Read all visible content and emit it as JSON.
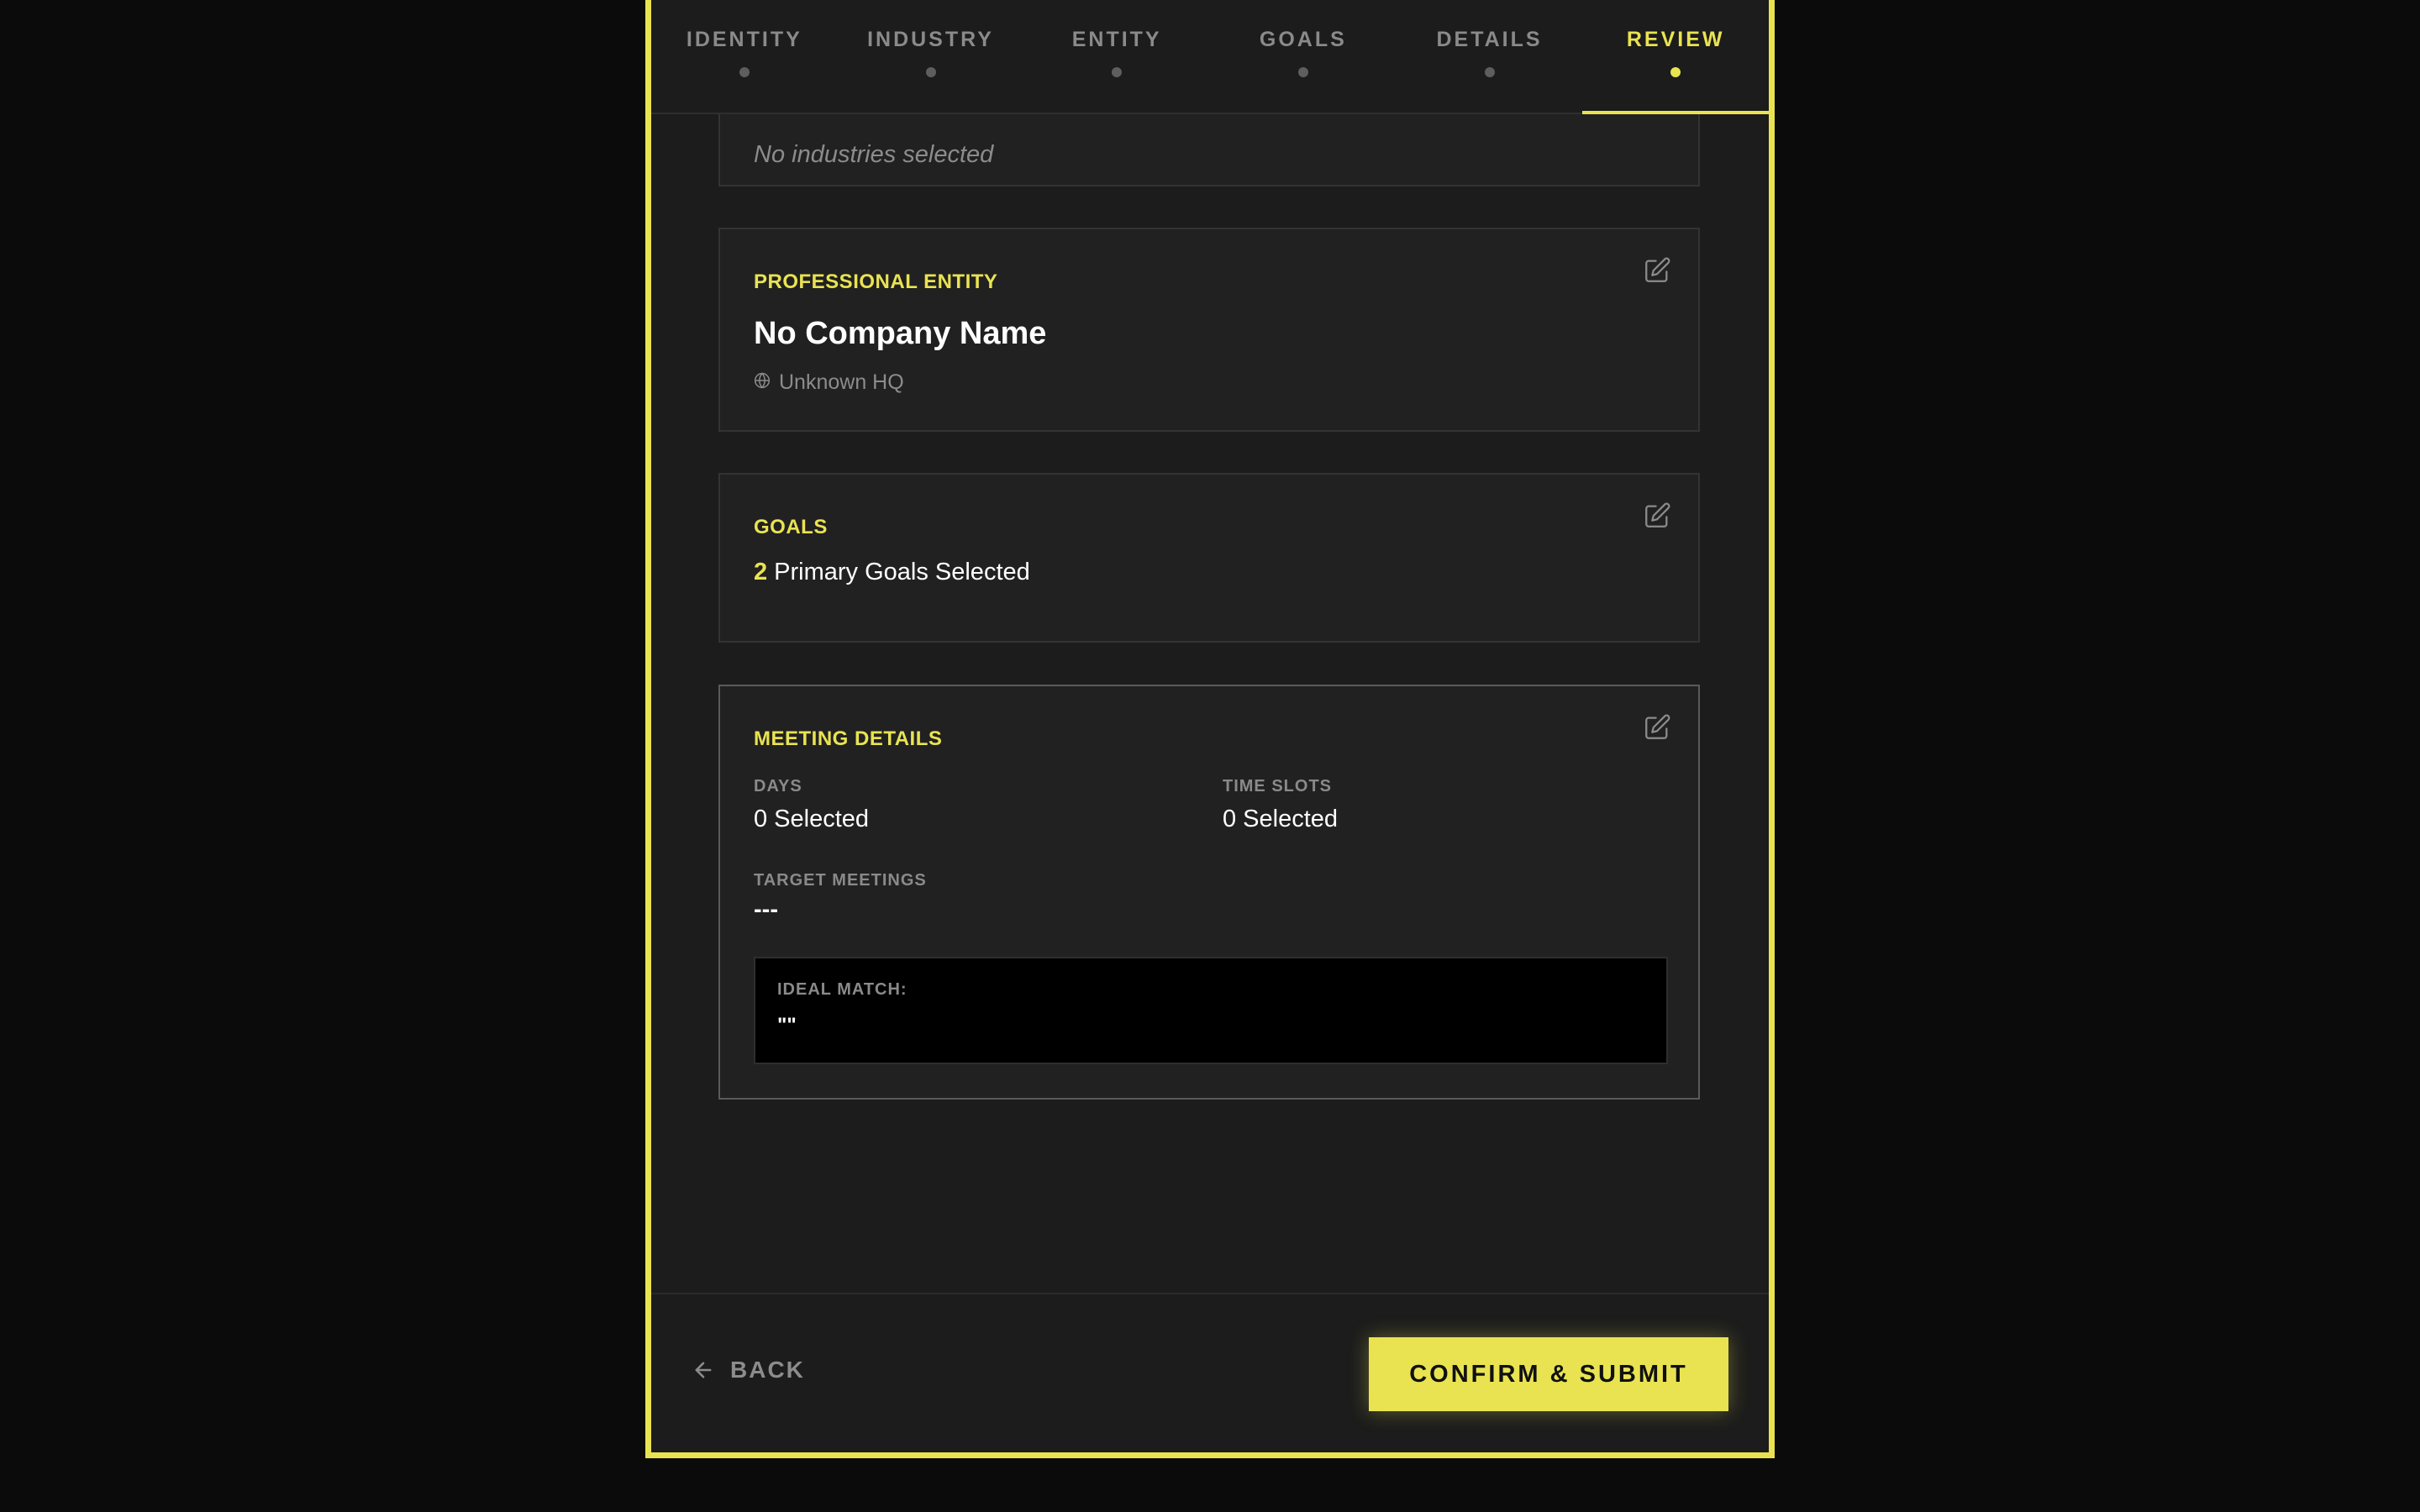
{
  "tabs": [
    {
      "label": "IDENTITY",
      "active": false
    },
    {
      "label": "INDUSTRY",
      "active": false
    },
    {
      "label": "ENTITY",
      "active": false
    },
    {
      "label": "GOALS",
      "active": false
    },
    {
      "label": "DETAILS",
      "active": false
    },
    {
      "label": "REVIEW",
      "active": true
    }
  ],
  "industry_card": {
    "empty_text": "No industries selected"
  },
  "entity_card": {
    "title": "PROFESSIONAL ENTITY",
    "company_name": "No Company Name",
    "hq": "Unknown HQ",
    "hq_icon": "globe-icon",
    "edit_icon": "edit-icon"
  },
  "goals_card": {
    "title": "GOALS",
    "count": "2",
    "text": "Primary Goals Selected",
    "edit_icon": "edit-icon"
  },
  "meeting_card": {
    "title": "MEETING DETAILS",
    "days_label": "DAYS",
    "days_value": "0 Selected",
    "slots_label": "TIME SLOTS",
    "slots_value": "0 Selected",
    "target_label": "TARGET MEETINGS",
    "target_value": "---",
    "ideal_label": "IDEAL MATCH:",
    "ideal_value": "\"\"",
    "edit_icon": "edit-icon"
  },
  "footer": {
    "back_label": "BACK",
    "back_icon": "arrow-left-icon",
    "submit_label": "CONFIRM & SUBMIT"
  },
  "colors": {
    "accent": "#e9e352",
    "background": "#0b0b0b",
    "panel": "#1c1c1c",
    "card": "#212121"
  }
}
